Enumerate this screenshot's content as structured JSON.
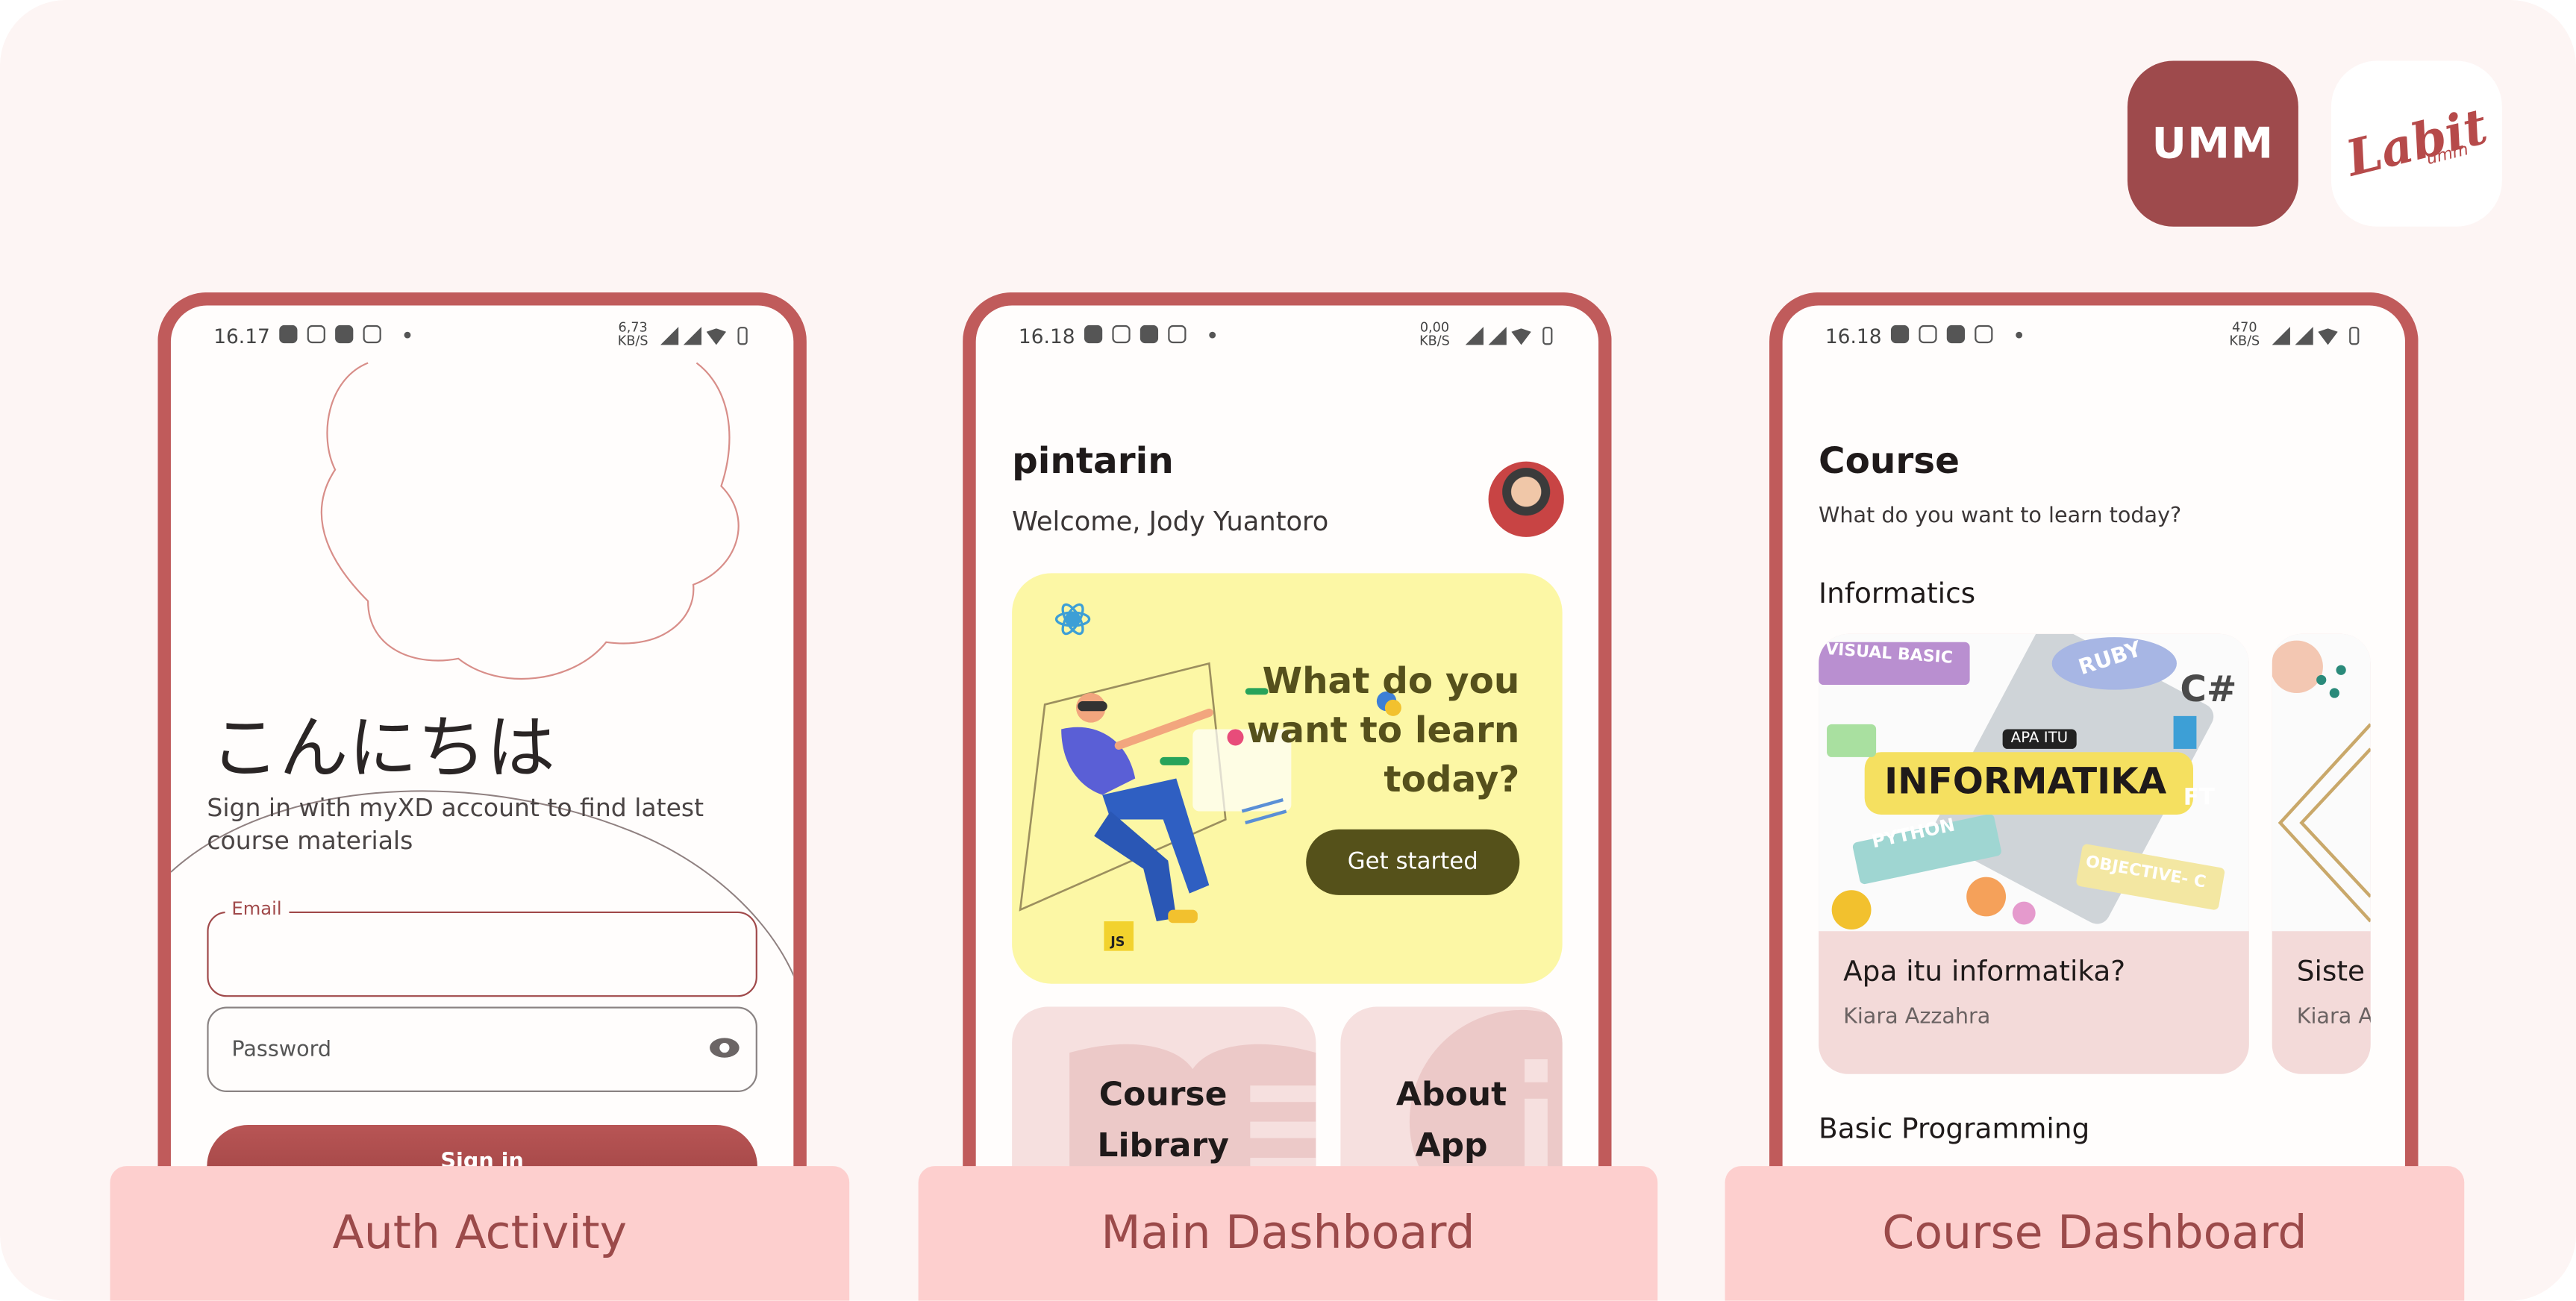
{
  "logos": {
    "umm": "UMM",
    "labit": "Labit",
    "labit_sub": "umm"
  },
  "phones": {
    "auth": {
      "status": {
        "time": "16.17",
        "speed": "6,73",
        "unit": "KB/S"
      },
      "greeting": "こんにちは",
      "subtitle": "Sign in with myXD account to find latest course materials",
      "email_label": "Email",
      "password_placeholder": "Password",
      "signin_label": "Sign in"
    },
    "main": {
      "status": {
        "time": "16.18",
        "speed": "0,00",
        "unit": "KB/S"
      },
      "app_name": "pintarin",
      "welcome": "Welcome, Jody Yuantoro",
      "hero_question": "What do you want to learn today?",
      "hero_button": "Get started",
      "tiles": [
        {
          "label": "Course Library"
        },
        {
          "label": "About App"
        }
      ]
    },
    "course": {
      "status": {
        "time": "16.18",
        "speed": "470",
        "unit": "KB/S"
      },
      "title": "Course",
      "subtitle": "What do you want to learn today?",
      "section1": "Informatics",
      "cards": [
        {
          "title": "Apa itu informatika?",
          "author": "Kiara Azzahra",
          "banner_small": "APA ITU",
          "banner": "INFORMATIKA",
          "tags": [
            "VISUAL BASIC",
            "RUBY",
            "C#",
            "PYTHON",
            "OBJECTIVE- C",
            "FT"
          ]
        },
        {
          "title": "Siste",
          "author": "Kiara A"
        }
      ],
      "section2": "Basic Programming"
    }
  },
  "labels": [
    "Auth Activity",
    "Main Dashboard",
    "Course Dashboard"
  ],
  "colors": {
    "accent": "#9e4a4c",
    "frame": "#c05b5b",
    "label_bg": "#fdcfce",
    "hero_bg": "#fcf7a5",
    "button_dark": "#55511a"
  }
}
